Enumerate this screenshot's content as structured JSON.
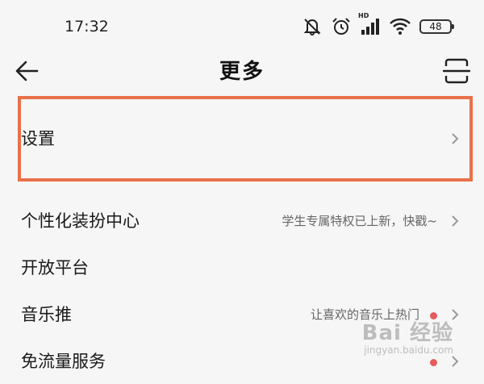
{
  "status_bar": {
    "time": "17:32",
    "network_badge": "HD",
    "battery": "48",
    "icons": [
      "mute-icon",
      "alarm-icon",
      "signal-icon",
      "wifi-icon",
      "battery-icon"
    ]
  },
  "header": {
    "title": "更多",
    "back_icon": "back-arrow-icon",
    "scan_icon": "scan-icon"
  },
  "list": {
    "items": [
      {
        "label": "设置",
        "hint": "",
        "dot": false,
        "chevron": true
      },
      {
        "label": "个性化装扮中心",
        "hint": "学生专属特权已上新，快戳~",
        "dot": false,
        "chevron": true
      },
      {
        "label": "开放平台",
        "hint": "",
        "dot": false,
        "chevron": false
      },
      {
        "label": "音乐推",
        "hint": "让喜欢的音乐上热门",
        "dot": true,
        "chevron": true
      },
      {
        "label": "免流量服务",
        "hint": "",
        "dot": true,
        "chevron": true
      }
    ]
  },
  "colors": {
    "highlight_border": "#e8714a",
    "notification_dot": "#e65b5b",
    "background": "#f6f6f6"
  },
  "watermark": {
    "main": "Bai 经验",
    "sub": "jingyan.baidu.com"
  }
}
